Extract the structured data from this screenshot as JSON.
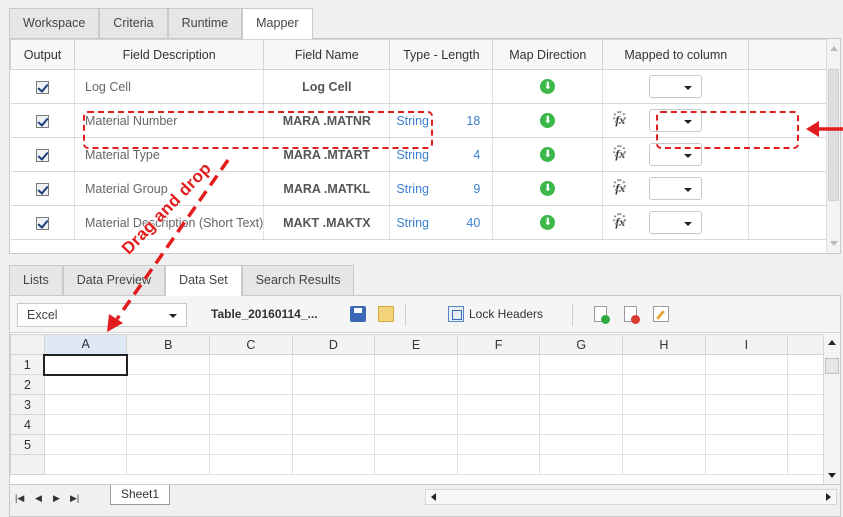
{
  "top_tabs": [
    "Workspace",
    "Criteria",
    "Runtime",
    "Mapper"
  ],
  "active_top_tab": "Mapper",
  "mapper": {
    "headers": {
      "output": "Output",
      "description": "Field Description",
      "name": "Field Name",
      "type": "Type - Length",
      "direction": "Map Direction",
      "mapped": "Mapped to column"
    },
    "rows": [
      {
        "output": true,
        "description": "Log Cell",
        "name": "Log Cell",
        "type": "",
        "length": "",
        "has_fx": false
      },
      {
        "output": true,
        "description": "Material Number",
        "name": "MARA .MATNR",
        "type": "String",
        "length": "18",
        "has_fx": true
      },
      {
        "output": true,
        "description": "Material Type",
        "name": "MARA .MTART",
        "type": "String",
        "length": "4",
        "has_fx": true
      },
      {
        "output": true,
        "description": "Material Group",
        "name": "MARA .MATKL",
        "type": "String",
        "length": "9",
        "has_fx": true
      },
      {
        "output": true,
        "description": "Material Description (Short Text)",
        "name": "MAKT .MAKTX",
        "type": "String",
        "length": "40",
        "has_fx": true
      }
    ]
  },
  "bottom_tabs": [
    "Lists",
    "Data Preview",
    "Data Set",
    "Search Results"
  ],
  "active_bottom_tab": "Data Set",
  "toolbar": {
    "source_select": "Excel",
    "table_name": "Table_20160114_...",
    "lock_headers": "Lock Headers"
  },
  "sheet": {
    "columns": [
      "A",
      "B",
      "C",
      "D",
      "E",
      "F",
      "G",
      "H",
      "I"
    ],
    "rows": [
      "1",
      "2",
      "3",
      "4",
      "5"
    ],
    "active_cell": "A1",
    "sheet_tab": "Sheet1"
  },
  "annotation": {
    "drag_label": "Drag and drop",
    "color": "#e31d1d"
  },
  "colors": {
    "type_text": "#3d7fd0",
    "direction_icon": "#3cb74a"
  }
}
